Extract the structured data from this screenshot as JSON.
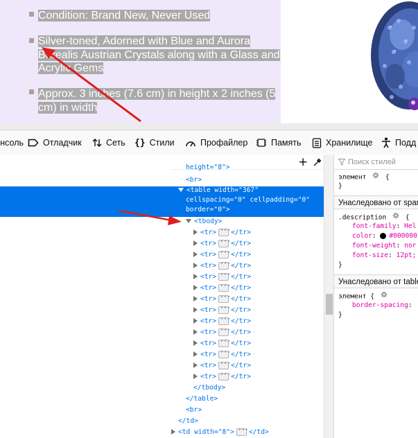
{
  "webpage": {
    "bullets": [
      "Condition: Brand New, Never Used",
      "Silver-toned, Adorned with Blue and Aurora Borealis Austrian Crystals along with a Glass and Acrylic Gems",
      "Approx. 3 inches (7.6 cm) in height x 2 inches (5 cm) in width"
    ]
  },
  "toolbar": {
    "tabs": [
      {
        "label": "Консоль",
        "icon": "console-icon"
      },
      {
        "label": "Отладчик",
        "icon": "debugger-icon"
      },
      {
        "label": "Сеть",
        "icon": "network-icon"
      },
      {
        "label": "Стили",
        "icon": "style-editor-icon"
      },
      {
        "label": "Профайлер",
        "icon": "profiler-icon"
      },
      {
        "label": "Память",
        "icon": "memory-icon"
      },
      {
        "label": "Хранилище",
        "icon": "storage-icon"
      },
      {
        "label": "Подд",
        "icon": "accessibility-icon"
      }
    ]
  },
  "markup": {
    "lines": {
      "height": "height=\"8\">",
      "br1": "<br>",
      "table1": "<table width=\"367\"",
      "table2": "cellspacing=\"0\" cellpadding=\"0\"",
      "table3": "border=\"0\">",
      "tbody": "<tbody>",
      "tr_open": "<tr>",
      "tr_close": "</tr>",
      "tbody_close": "</tbody>",
      "table_close": "</table>",
      "br2": "<br>",
      "td_close": "</td>",
      "td_open": "<td width=\"8\">",
      "td_close2": "</td>"
    },
    "tr_count": 14
  },
  "rules": {
    "filter_placeholder": "Поиск стилей",
    "element_label": "элемент",
    "brace_open": "{",
    "brace_close": "}",
    "inherited_1": "Унаследовано от span",
    "selector": ".description",
    "props": [
      {
        "name": "font-family",
        "value": "Hel"
      },
      {
        "name": "color",
        "value": "#000000"
      },
      {
        "name": "font-weight",
        "value": "nor"
      },
      {
        "name": "font-size",
        "value": "12pt;"
      }
    ],
    "inherited_2": "Унаследовано от table",
    "element_label_2": "элемент",
    "props2": [
      {
        "name": "border-spacing",
        "value": ""
      }
    ]
  },
  "colors": {
    "selection": "#0074e8",
    "tag": "#0074e8",
    "property": "#dd00a9",
    "annotation_arrow": "#e01e1e"
  }
}
